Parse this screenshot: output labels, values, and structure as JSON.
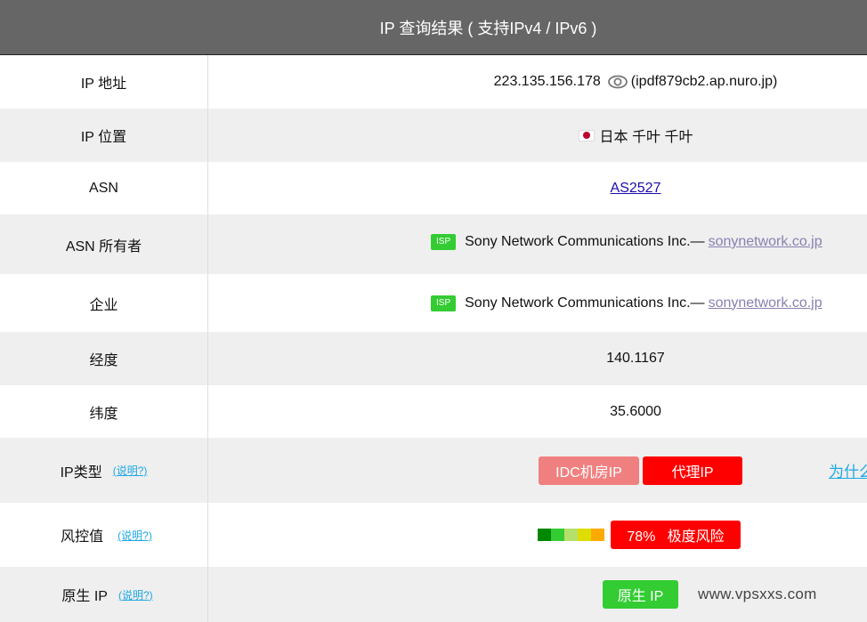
{
  "header": {
    "title": "IP 查询结果 ( 支持IPv4 / IPv6 )"
  },
  "rows": {
    "ip_address": {
      "label": "IP 地址",
      "ip": "223.135.156.178",
      "icon": "eye-icon",
      "hostname": "(ipdf879cb2.ap.nuro.jp)"
    },
    "ip_location": {
      "label": "IP 位置",
      "flag": "japan-flag",
      "location": "日本 千叶 千叶"
    },
    "asn": {
      "label": "ASN",
      "value": "AS2527"
    },
    "asn_owner": {
      "label": "ASN 所有者",
      "badge": "ISP",
      "name": "Sony Network Communications Inc.—",
      "domain": "sonynetwork.co.jp"
    },
    "enterprise": {
      "label": "企业",
      "badge": "ISP",
      "name": "Sony Network Communications Inc.—",
      "domain": "sonynetwork.co.jp"
    },
    "longitude": {
      "label": "经度",
      "value": "140.1167"
    },
    "latitude": {
      "label": "纬度",
      "value": "35.6000"
    },
    "ip_type": {
      "label": "IP类型",
      "explain": "(说明?)",
      "tags": [
        "IDC机房IP",
        "代理IP"
      ],
      "why_link": "为什么"
    },
    "risk": {
      "label": "风控值",
      "explain": "(说明?)",
      "score_percent": 78,
      "score_text": "78%   极度风险",
      "level": "极度风险",
      "scale_colors": [
        "#008800",
        "#33cc33",
        "#b5e06a",
        "#dddd00",
        "#ffaa00"
      ]
    },
    "native_ip": {
      "label": "原生 IP",
      "explain": "(说明?)",
      "tag": "原生 IP",
      "watermark": "www.vpsxxs.com"
    }
  },
  "colors": {
    "header_bg": "#666666",
    "alt_row": "#efefef",
    "isp_green": "#33cc33",
    "danger_red": "#ff0000",
    "idc_pink": "#f08080",
    "link_blue": "#1ea7e6"
  }
}
